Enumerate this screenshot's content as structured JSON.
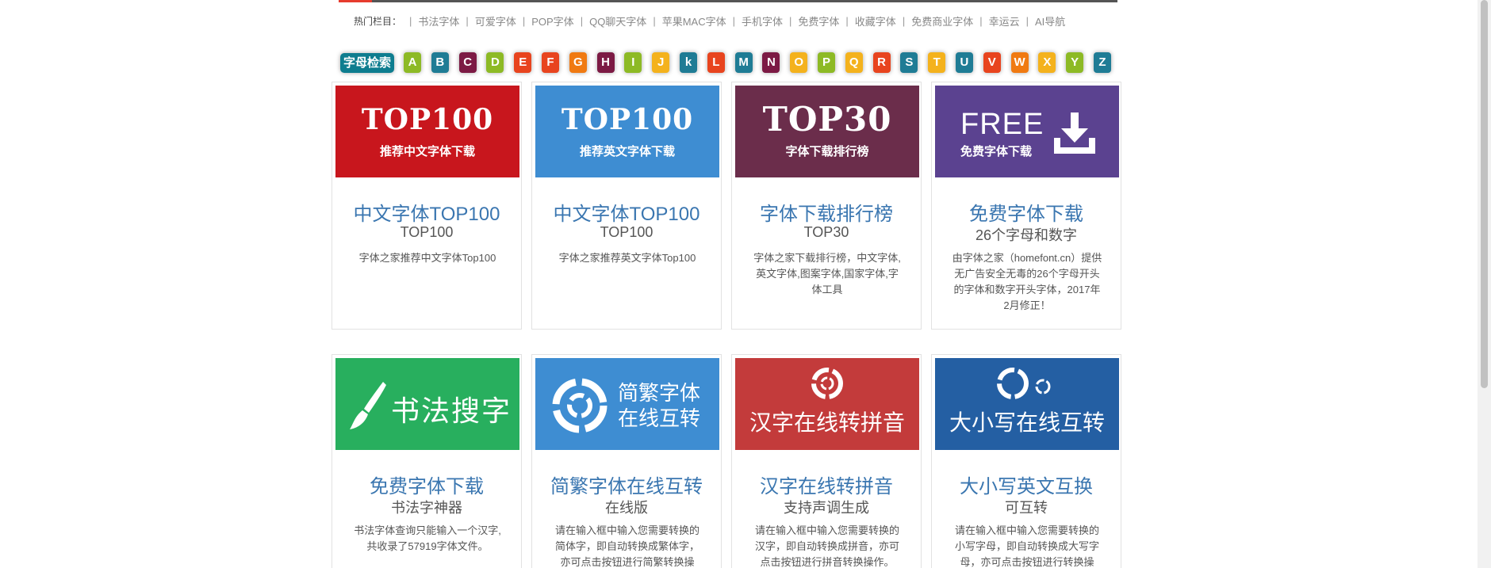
{
  "hotnav": {
    "label": "热门栏目：",
    "items": [
      "书法字体",
      "可爱字体",
      "POP字体",
      "QQ聊天字体",
      "苹果MAC字体",
      "手机字体",
      "免费字体",
      "收藏字体",
      "免费商业字体",
      "幸运云",
      "AI导航"
    ]
  },
  "letters": {
    "search_label": "字母检索",
    "items": [
      {
        "ch": "A",
        "color": "#8dba25"
      },
      {
        "ch": "B",
        "color": "#1f7c95"
      },
      {
        "ch": "C",
        "color": "#7c1a44"
      },
      {
        "ch": "D",
        "color": "#8dba25"
      },
      {
        "ch": "E",
        "color": "#e8441e"
      },
      {
        "ch": "F",
        "color": "#e8441e"
      },
      {
        "ch": "G",
        "color": "#f07a12"
      },
      {
        "ch": "H",
        "color": "#7c1a44"
      },
      {
        "ch": "I",
        "color": "#8dba25"
      },
      {
        "ch": "J",
        "color": "#f4b21d"
      },
      {
        "ch": "k",
        "color": "#1f7c95"
      },
      {
        "ch": "L",
        "color": "#e8441e"
      },
      {
        "ch": "M",
        "color": "#1f7c95"
      },
      {
        "ch": "N",
        "color": "#7c1a44"
      },
      {
        "ch": "O",
        "color": "#f4b21d"
      },
      {
        "ch": "P",
        "color": "#8dba25"
      },
      {
        "ch": "Q",
        "color": "#f4b21d"
      },
      {
        "ch": "R",
        "color": "#e8441e"
      },
      {
        "ch": "S",
        "color": "#1f7c95"
      },
      {
        "ch": "T",
        "color": "#f4b21d"
      },
      {
        "ch": "U",
        "color": "#1f7c95"
      },
      {
        "ch": "V",
        "color": "#e8441e"
      },
      {
        "ch": "W",
        "color": "#f07a12"
      },
      {
        "ch": "X",
        "color": "#f4b21d"
      },
      {
        "ch": "Y",
        "color": "#8dba25"
      },
      {
        "ch": "Z",
        "color": "#1f7c95"
      }
    ]
  },
  "cards": [
    {
      "banner": {
        "type": "top",
        "big": "TOP100",
        "sub": "推荐中文字体下载",
        "bg": "#c8161d"
      },
      "title": "中文字体TOP100",
      "subtitle": "TOP100",
      "desc": "字体之家推荐中文字体Top100"
    },
    {
      "banner": {
        "type": "top",
        "big": "TOP100",
        "sub": "推荐英文字体下载",
        "bg": "#3e8dd2"
      },
      "title": "中文字体TOP100",
      "subtitle": "TOP100",
      "desc": "字体之家推荐英文字体Top100"
    },
    {
      "banner": {
        "type": "top",
        "big": "TOP30",
        "sub": "字体下载排行榜",
        "bg": "#6b2d4b"
      },
      "title": "字体下载排行榜",
      "subtitle": "TOP30",
      "desc": "字体之家下载排行榜，中文字体,英文字体,图案字体,国家字体,字体工具"
    },
    {
      "banner": {
        "type": "free",
        "big": "FREE",
        "sub": "免费字体下载",
        "bg": "#5b4290"
      },
      "title": "免费字体下载",
      "subtitle": "26个字母和数字",
      "desc": "由字体之家（homefont.cn）提供无广告安全无毒的26个字母开头的字体和数字开头字体，2017年2月修正！"
    },
    {
      "banner": {
        "type": "calli",
        "big": "书法搜字",
        "bg": "#28af5e"
      },
      "title": "免费字体下载",
      "subtitle": "书法字神器",
      "desc": "书法字体查询只能输入一个汉字,共收录了57919字体文件。"
    },
    {
      "banner": {
        "type": "jf",
        "line1": "简繁字体",
        "line2": "在线互转",
        "bg": "#3e8dd2"
      },
      "title": "简繁字体在线互转",
      "subtitle": "在线版",
      "desc": "请在输入框中输入您需要转换的简体字，即自动转换成繁体字，亦可点击按钮进行简繁转换操作。"
    },
    {
      "banner": {
        "type": "py",
        "big": "汉字在线转拼音",
        "bg": "#c33b3b"
      },
      "title": "汉字在线转拼音",
      "subtitle": "支持声调生成",
      "desc": "请在输入框中输入您需要转换的汉字，即自动转换成拼音，亦可点击按钮进行拼音转换操作。"
    },
    {
      "banner": {
        "type": "dx",
        "big": "大小写在线互转",
        "bg": "#245fa3"
      },
      "title": "大小写英文互换",
      "subtitle": "可互转",
      "desc": "请在输入框中输入您需要转换的小写字母，即自动转换成大写字母，亦可点击按钮进行转换操作。"
    }
  ],
  "scrollbar": {
    "track_color": "#f1f1f1",
    "thumb_color": "#c1c1c1"
  }
}
